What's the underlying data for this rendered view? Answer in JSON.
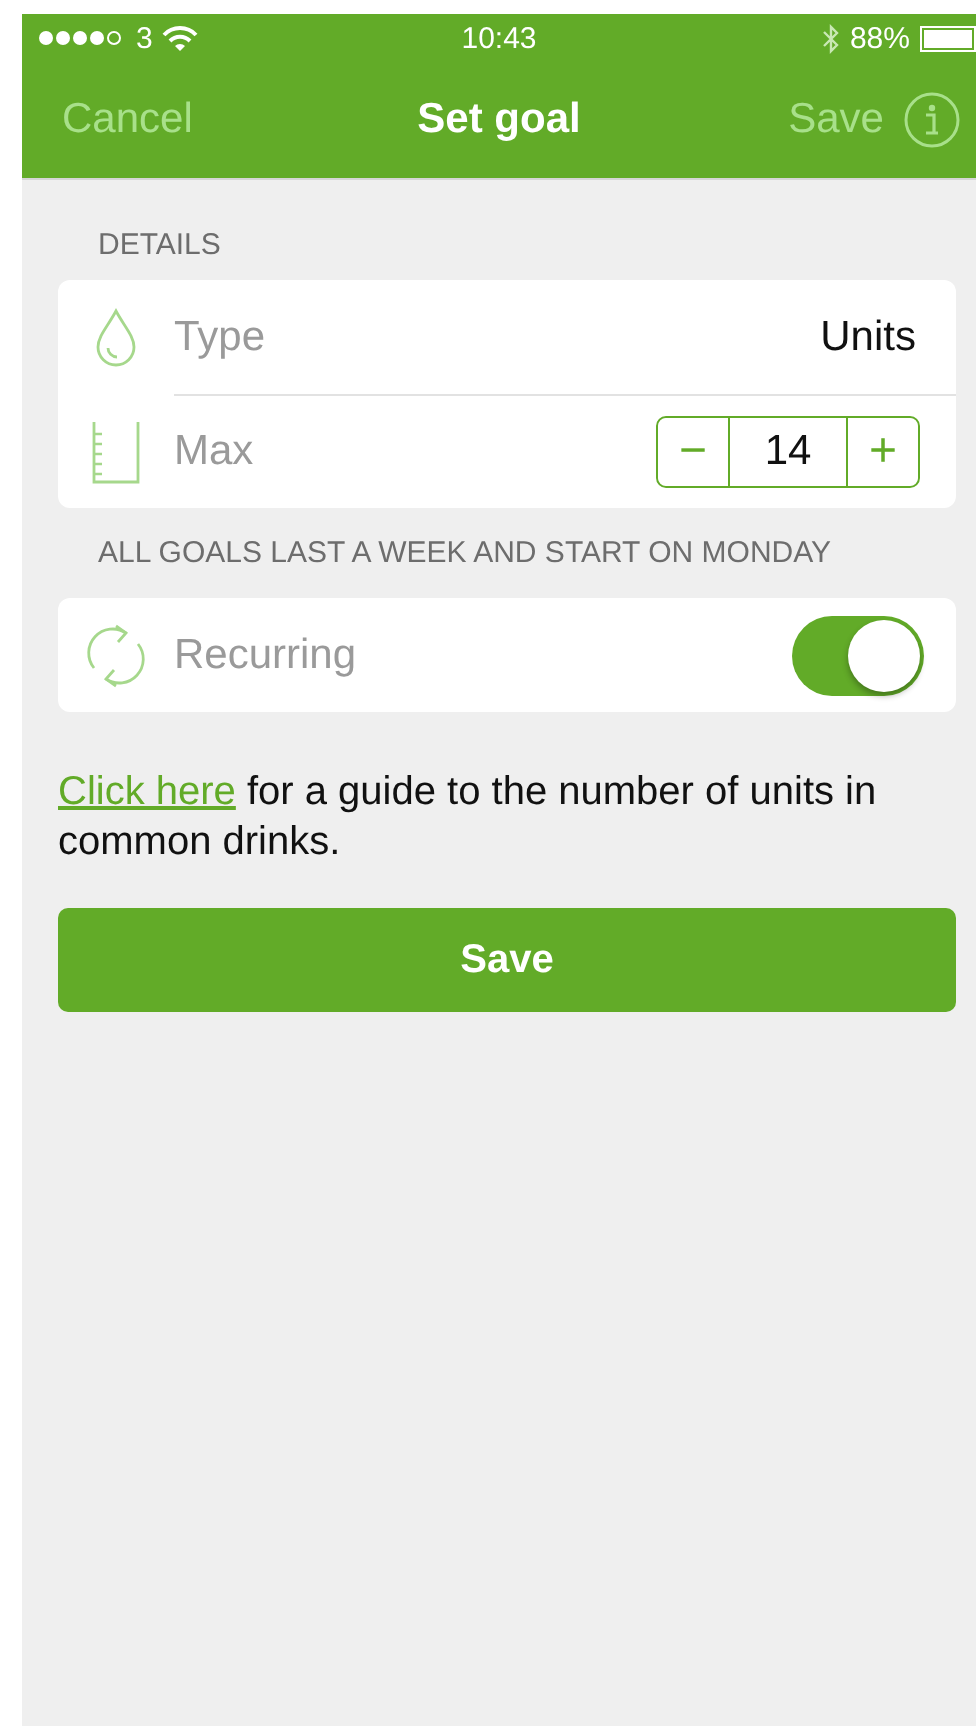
{
  "status_bar": {
    "carrier": "3",
    "time": "10:43",
    "battery": "88%"
  },
  "nav": {
    "left": "Cancel",
    "title": "Set goal",
    "right": "Save"
  },
  "details": {
    "header": "DETAILS",
    "rows": [
      {
        "kind": "value",
        "label": "Type",
        "value": "Units"
      },
      {
        "kind": "stepper",
        "label": "Max",
        "value": "14",
        "minus": "−",
        "plus": "+"
      }
    ]
  },
  "footnote": "ALL GOALS LAST A WEEK AND START ON MONDAY",
  "recurring": {
    "label": "Recurring",
    "on": true
  },
  "guide": {
    "link": "Click here",
    "text": "for a guide to the number of units in common drinks."
  },
  "save_button": "Save"
}
